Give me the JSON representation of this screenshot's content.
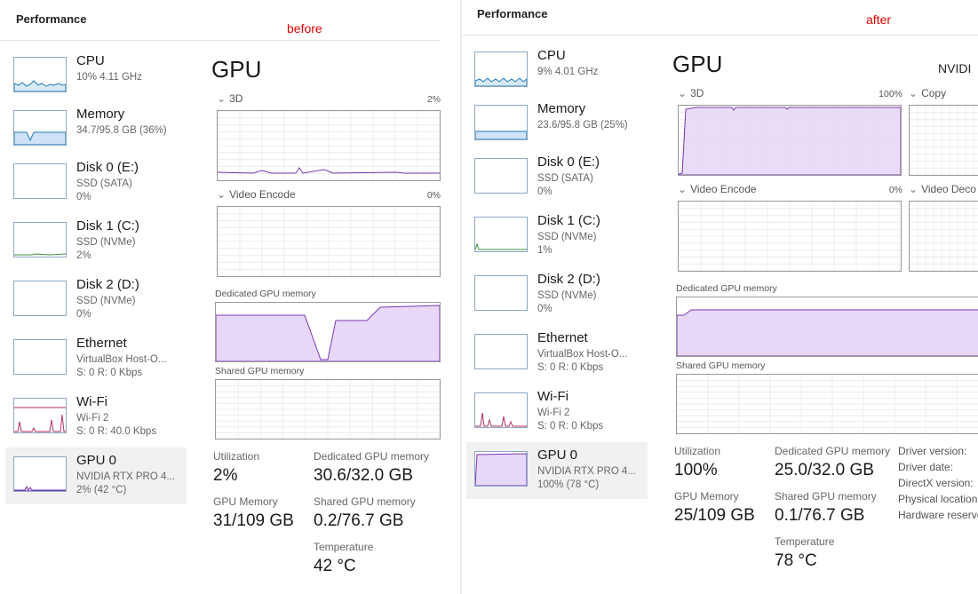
{
  "before": {
    "panel_title": "Performance",
    "tag": "before",
    "sidebar": [
      {
        "name": "CPU",
        "sub1": "10% 4.11 GHz",
        "sub2": ""
      },
      {
        "name": "Memory",
        "sub1": "34.7/95.8 GB (36%)",
        "sub2": ""
      },
      {
        "name": "Disk 0 (E:)",
        "sub1": "SSD (SATA)",
        "sub2": "0%"
      },
      {
        "name": "Disk 1 (C:)",
        "sub1": "SSD (NVMe)",
        "sub2": "2%"
      },
      {
        "name": "Disk 2 (D:)",
        "sub1": "SSD (NVMe)",
        "sub2": "0%"
      },
      {
        "name": "Ethernet",
        "sub1": "VirtualBox Host-O...",
        "sub2": "S: 0 R: 0 Kbps"
      },
      {
        "name": "Wi-Fi",
        "sub1": "Wi-Fi 2",
        "sub2": "S: 0 R: 40.0 Kbps"
      },
      {
        "name": "GPU 0",
        "sub1": "NVIDIA RTX PRO 4...",
        "sub2": "2% (42 °C)"
      }
    ],
    "gpu_title": "GPU",
    "engines": [
      {
        "label": "3D",
        "pct": "2%"
      },
      {
        "label": "Video Encode",
        "pct": "0%"
      }
    ],
    "dedicated_label": "Dedicated GPU memory",
    "shared_label": "Shared GPU memory",
    "stats": {
      "utilization_label": "Utilization",
      "utilization": "2%",
      "dedicated_label": "Dedicated GPU memory",
      "dedicated": "30.6/32.0 GB",
      "gpumem_label": "GPU Memory",
      "gpumem": "31/109 GB",
      "shared_label": "Shared GPU memory",
      "shared": "0.2/76.7 GB",
      "temp_label": "Temperature",
      "temp": "42 °C"
    }
  },
  "after": {
    "panel_title": "Performance",
    "tag": "after",
    "sidebar": [
      {
        "name": "CPU",
        "sub1": "9% 4.01 GHz",
        "sub2": ""
      },
      {
        "name": "Memory",
        "sub1": "23.6/95.8 GB (25%)",
        "sub2": ""
      },
      {
        "name": "Disk 0 (E:)",
        "sub1": "SSD (SATA)",
        "sub2": "0%"
      },
      {
        "name": "Disk 1 (C:)",
        "sub1": "SSD (NVMe)",
        "sub2": "1%"
      },
      {
        "name": "Disk 2 (D:)",
        "sub1": "SSD (NVMe)",
        "sub2": "0%"
      },
      {
        "name": "Ethernet",
        "sub1": "VirtualBox Host-O...",
        "sub2": "S: 0 R: 0 Kbps"
      },
      {
        "name": "Wi-Fi",
        "sub1": "Wi-Fi 2",
        "sub2": "S: 0 R: 0 Kbps"
      },
      {
        "name": "GPU 0",
        "sub1": "NVIDIA RTX PRO 4...",
        "sub2": "100% (78 °C)"
      }
    ],
    "gpu_title": "GPU",
    "gpu_model": "NVIDI",
    "engines": [
      {
        "label": "3D",
        "pct": "100%"
      },
      {
        "label": "Copy",
        "pct": ""
      },
      {
        "label": "Video Encode",
        "pct": "0%"
      },
      {
        "label": "Video Deco",
        "pct": ""
      }
    ],
    "dedicated_label": "Dedicated GPU memory",
    "shared_label": "Shared GPU memory",
    "stats": {
      "utilization_label": "Utilization",
      "utilization": "100%",
      "dedicated_label": "Dedicated GPU memory",
      "dedicated": "25.0/32.0 GB",
      "gpumem_label": "GPU Memory",
      "gpumem": "25/109 GB",
      "shared_label": "Shared GPU memory",
      "shared": "0.1/76.7 GB",
      "temp_label": "Temperature",
      "temp": "78 °C"
    },
    "info_labels": [
      "Driver version:",
      "Driver date:",
      "DirectX version:",
      "Physical location",
      "Hardware reserve"
    ]
  },
  "colors": {
    "tag": "#e00000",
    "gpu_fill": "#e7d8f8",
    "gpu_line": "#7a36b1",
    "cpu_line": "#1f7bb5",
    "mem_fill": "#cfe2f7",
    "disk_line": "#3d8f3d",
    "wifi_line": "#b3325e"
  }
}
